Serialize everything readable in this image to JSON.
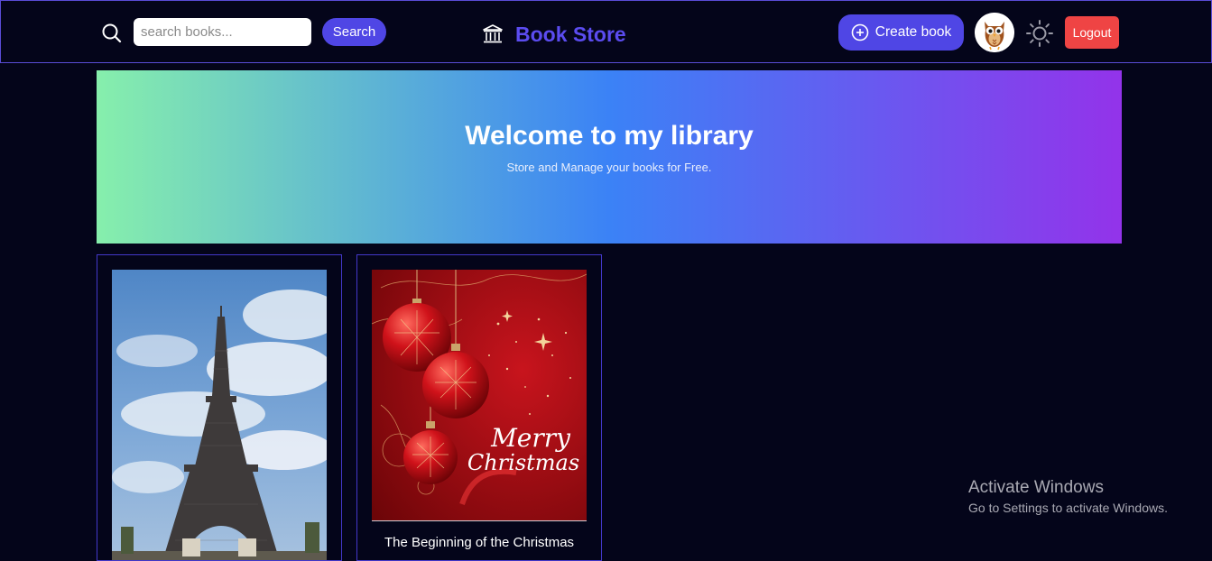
{
  "header": {
    "search": {
      "placeholder": "search books...",
      "value": "",
      "button_label": "Search"
    },
    "brand_title": "Book Store",
    "create_button_label": "Create book",
    "logout_label": "Logout"
  },
  "hero": {
    "title": "Welcome to my library",
    "subtitle": "Store and Manage your books for Free."
  },
  "books": [
    {
      "title": "",
      "cover": "eiffel-tower-photo"
    },
    {
      "title": "The Beginning of the Christmas",
      "cover": "merry-christmas-ornaments"
    }
  ],
  "christmas_cover_text": {
    "line1": "Merry",
    "line2": "Christmas"
  },
  "os_watermark": {
    "title": "Activate Windows",
    "subtitle": "Go to Settings to activate Windows."
  },
  "colors": {
    "background": "#04051a",
    "accent": "#4f46e5",
    "brand": "#5b4cf0",
    "logout": "#ef4444",
    "hero_gradient": [
      "#86efac",
      "#3b82f6",
      "#9333ea"
    ]
  }
}
